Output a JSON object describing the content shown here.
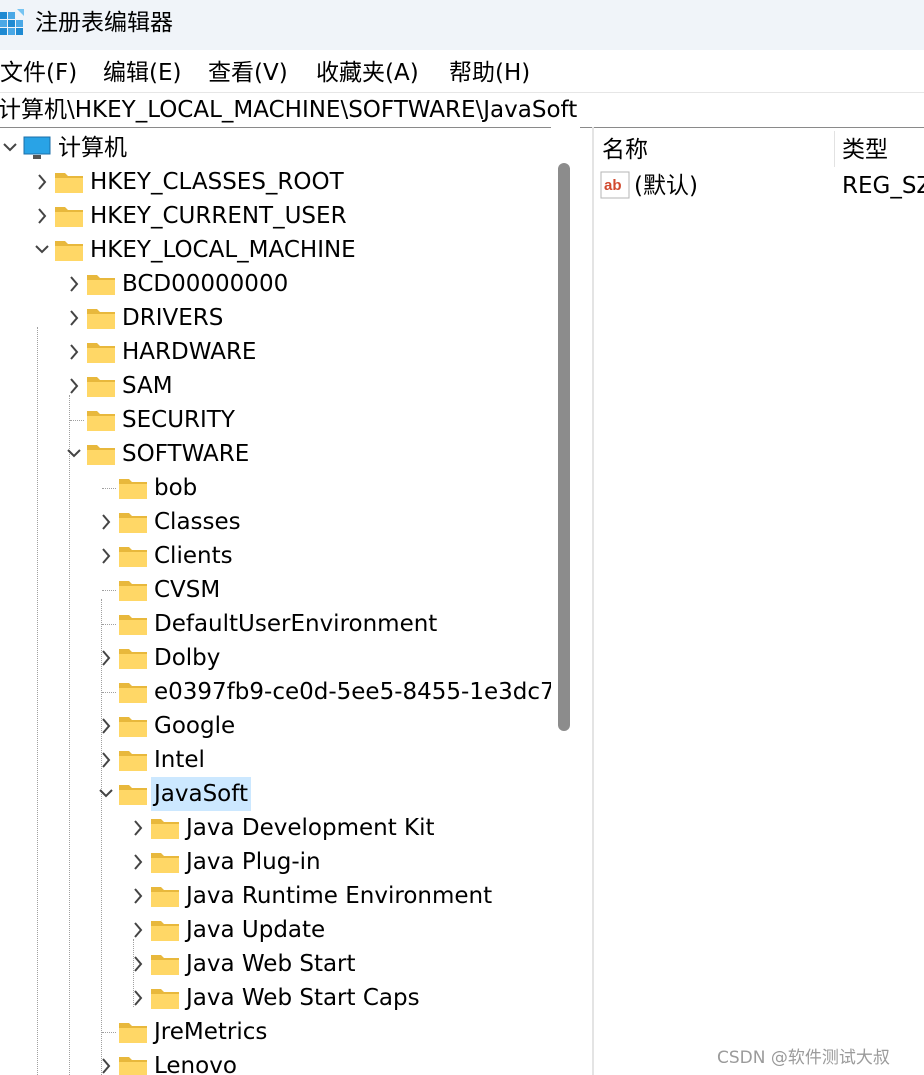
{
  "window": {
    "title": "注册表编辑器"
  },
  "menu": [
    "文件(F)",
    "编辑(E)",
    "查看(V)",
    "收藏夹(A)",
    "帮助(H)"
  ],
  "address": "计算机\\HKEY_LOCAL_MACHINE\\SOFTWARE\\JavaSoft",
  "tree": [
    {
      "label": "计算机",
      "icon": "computer-icon",
      "expander": "expanded"
    },
    {
      "label": "HKEY_CLASSES_ROOT",
      "icon": "folder-icon",
      "expander": "collapsed"
    },
    {
      "label": "HKEY_CURRENT_USER",
      "icon": "folder-icon",
      "expander": "collapsed"
    },
    {
      "label": "HKEY_LOCAL_MACHINE",
      "icon": "folder-icon",
      "expander": "expanded"
    },
    {
      "label": "BCD00000000",
      "icon": "folder-icon",
      "expander": "collapsed"
    },
    {
      "label": "DRIVERS",
      "icon": "folder-icon",
      "expander": "collapsed"
    },
    {
      "label": "HARDWARE",
      "icon": "folder-icon",
      "expander": "collapsed"
    },
    {
      "label": "SAM",
      "icon": "folder-icon",
      "expander": "collapsed"
    },
    {
      "label": "SECURITY",
      "icon": "folder-icon",
      "expander": "none"
    },
    {
      "label": "SOFTWARE",
      "icon": "folder-icon",
      "expander": "expanded"
    },
    {
      "label": "bob",
      "icon": "folder-icon",
      "expander": "none"
    },
    {
      "label": "Classes",
      "icon": "folder-icon",
      "expander": "collapsed"
    },
    {
      "label": "Clients",
      "icon": "folder-icon",
      "expander": "collapsed"
    },
    {
      "label": "CVSM",
      "icon": "folder-icon",
      "expander": "none"
    },
    {
      "label": "DefaultUserEnvironment",
      "icon": "folder-icon",
      "expander": "none"
    },
    {
      "label": "Dolby",
      "icon": "folder-icon",
      "expander": "collapsed"
    },
    {
      "label": "e0397fb9-ce0d-5ee5-8455-1e3dc7",
      "icon": "folder-icon",
      "expander": "none"
    },
    {
      "label": "Google",
      "icon": "folder-icon",
      "expander": "collapsed"
    },
    {
      "label": "Intel",
      "icon": "folder-icon",
      "expander": "collapsed"
    },
    {
      "label": "JavaSoft",
      "icon": "folder-icon",
      "expander": "expanded",
      "selected": true
    },
    {
      "label": "Java Development Kit",
      "icon": "folder-icon",
      "expander": "collapsed"
    },
    {
      "label": "Java Plug-in",
      "icon": "folder-icon",
      "expander": "collapsed"
    },
    {
      "label": "Java Runtime Environment",
      "icon": "folder-icon",
      "expander": "collapsed"
    },
    {
      "label": "Java Update",
      "icon": "folder-icon",
      "expander": "collapsed"
    },
    {
      "label": "Java Web Start",
      "icon": "folder-icon",
      "expander": "collapsed"
    },
    {
      "label": "Java Web Start Caps",
      "icon": "folder-icon",
      "expander": "collapsed"
    },
    {
      "label": "JreMetrics",
      "icon": "folder-icon",
      "expander": "none"
    },
    {
      "label": "Lenovo",
      "icon": "folder-icon",
      "expander": "collapsed"
    }
  ],
  "list": {
    "columns": [
      "名称",
      "类型"
    ],
    "rows": [
      {
        "name": "(默认)",
        "type": "REG_SZ",
        "icon": "string-value-icon"
      }
    ]
  },
  "watermark": "CSDN @软件测试大叔",
  "colors": {
    "selection": "#cce8ff",
    "folder": "#ffd766",
    "titlebar": "#f0f4f9"
  }
}
